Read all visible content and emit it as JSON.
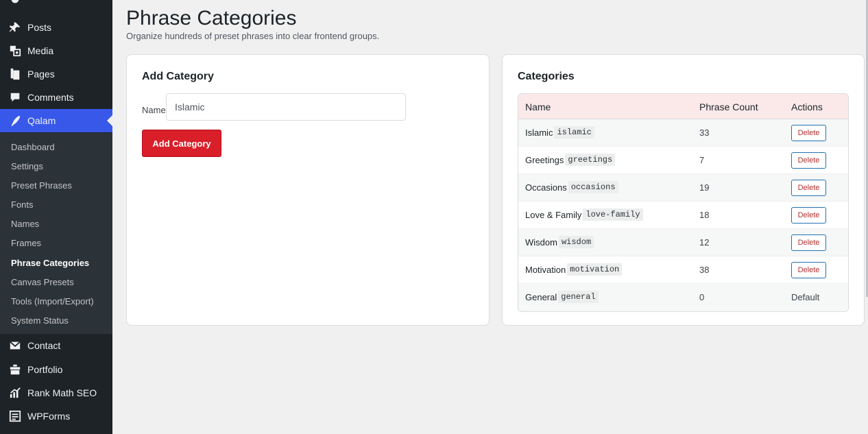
{
  "sidebar": {
    "top_items": [
      {
        "label": "Posts",
        "icon": "pin-icon"
      },
      {
        "label": "Media",
        "icon": "media-icon"
      },
      {
        "label": "Pages",
        "icon": "pages-icon"
      },
      {
        "label": "Comments",
        "icon": "comments-icon"
      },
      {
        "label": "Qalam",
        "icon": "pen-icon"
      }
    ],
    "sub_items": [
      "Dashboard",
      "Settings",
      "Preset Phrases",
      "Fonts",
      "Names",
      "Frames",
      "Phrase Categories",
      "Canvas Presets",
      "Tools (Import/Export)",
      "System Status"
    ],
    "bottom_items": [
      {
        "label": "Contact",
        "icon": "mail-icon"
      },
      {
        "label": "Portfolio",
        "icon": "portfolio-icon"
      },
      {
        "label": "Rank Math SEO",
        "icon": "chart-icon"
      },
      {
        "label": "WPForms",
        "icon": "forms-icon"
      }
    ]
  },
  "page": {
    "title": "Phrase Categories",
    "subtitle": "Organize hundreds of preset phrases into clear frontend groups."
  },
  "add_card": {
    "title": "Add Category",
    "name_label": "Name",
    "name_value": "Islamic",
    "button_label": "Add Category"
  },
  "list_card": {
    "title": "Categories",
    "headers": {
      "name": "Name",
      "count": "Phrase Count",
      "actions": "Actions"
    },
    "rows": [
      {
        "name": "Islamic",
        "slug": "islamic",
        "count": "33",
        "action": "Delete"
      },
      {
        "name": "Greetings",
        "slug": "greetings",
        "count": "7",
        "action": "Delete"
      },
      {
        "name": "Occasions",
        "slug": "occasions",
        "count": "19",
        "action": "Delete"
      },
      {
        "name": "Love & Family",
        "slug": "love-family",
        "count": "18",
        "action": "Delete"
      },
      {
        "name": "Wisdom",
        "slug": "wisdom",
        "count": "12",
        "action": "Delete"
      },
      {
        "name": "Motivation",
        "slug": "motivation",
        "count": "38",
        "action": "Delete"
      },
      {
        "name": "General",
        "slug": "general",
        "count": "0",
        "action": "Default"
      }
    ]
  },
  "colors": {
    "accent": "#3858e9",
    "primary_button": "#d91f2a",
    "sidebar_bg": "#1d2327"
  }
}
